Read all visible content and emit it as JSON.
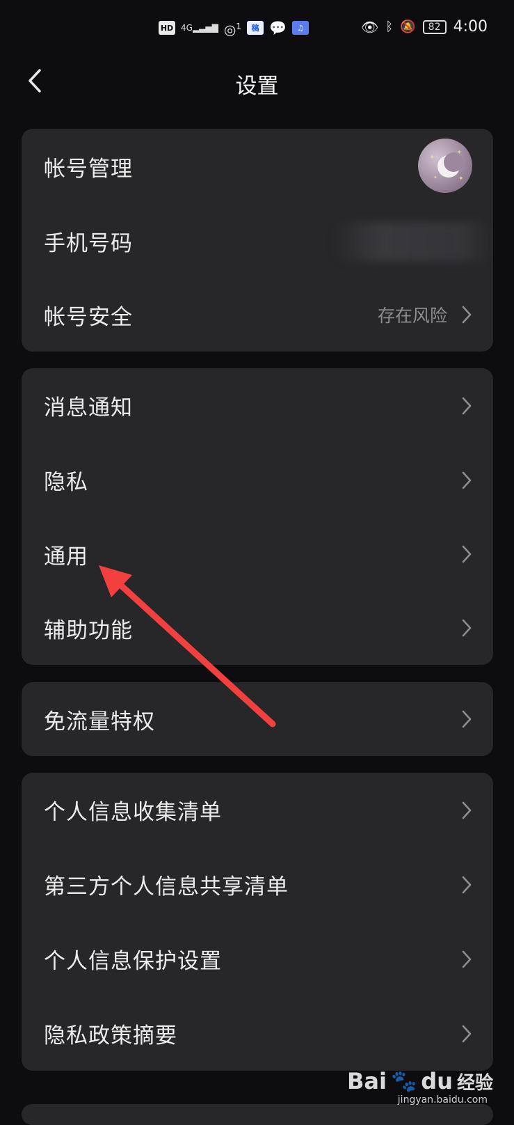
{
  "status_bar": {
    "hd": "HD",
    "network": "4G",
    "hotspot_count": "1",
    "app_badge": "稿",
    "battery": "82",
    "time": "4:00"
  },
  "header": {
    "title": "设置"
  },
  "groups": [
    {
      "items": [
        {
          "label": "帐号管理"
        },
        {
          "label": "手机号码"
        },
        {
          "label": "帐号安全",
          "value": "存在风险"
        }
      ]
    },
    {
      "items": [
        {
          "label": "消息通知"
        },
        {
          "label": "隐私"
        },
        {
          "label": "通用"
        },
        {
          "label": "辅助功能"
        }
      ]
    },
    {
      "items": [
        {
          "label": "免流量特权"
        }
      ]
    },
    {
      "items": [
        {
          "label": "个人信息收集清单"
        },
        {
          "label": "第三方个人信息共享清单"
        },
        {
          "label": "个人信息保护设置"
        },
        {
          "label": "隐私政策摘要"
        }
      ]
    }
  ],
  "watermark": {
    "brand": "Bai",
    "brand2": "du",
    "cn": "经验",
    "site": "jingyan.baidu.com"
  },
  "colors": {
    "arrow": "#f2403f",
    "card": "#27272a",
    "background": "#0d0d0f"
  }
}
